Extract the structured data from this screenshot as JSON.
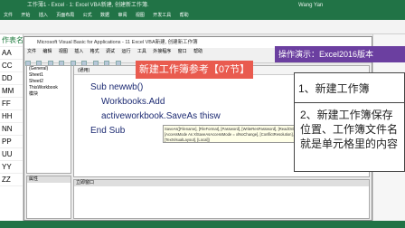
{
  "excel": {
    "title": "工作薄1 - Excel  ·  1: Excel VBA新建, 创建新工作簿.",
    "user": "Wang Yan",
    "tabs": [
      "文件",
      "开始",
      "插入",
      "页面布局",
      "公式",
      "数据",
      "审阅",
      "视图",
      "开发工具",
      "帮助"
    ],
    "row_labels": [
      "作表名",
      "AA",
      "CC",
      "DD",
      "MM",
      "FF",
      "HH",
      "NN",
      "PP",
      "UU",
      "YY",
      "ZZ"
    ]
  },
  "vbe": {
    "title": "Microsoft Visual Basic for Applications - 11 Excel VBA新建, 创建新工作簿",
    "menu": [
      "文件",
      "编辑",
      "视图",
      "插入",
      "格式",
      "调试",
      "运行",
      "工具",
      "外接程序",
      "窗口",
      "帮助"
    ],
    "project_items": [
      "(General)",
      "Sheet1",
      "Sheet2",
      "ThisWorkbook",
      "模块"
    ],
    "code_header": "(通用)",
    "code_lines": [
      "Sub newwb()",
      "Workbooks.Add",
      "activeworkbook.SaveAs thisw",
      "End Sub"
    ],
    "tooltip": "SaveAs([Filename], [FileFormat], [Password], [WriteResPassword], [ReadOnlyRecommended], [CreateBackup], [AccessMode As XlSaveAsAccessMode = xlNoChange], [ConflictResolution], [AddToMru], [TextCodepage], [TextVisualLayout], [Local])",
    "immediate_caption": "立即窗口",
    "props_caption": "属性"
  },
  "overlay": {
    "annotation_title": "新建工作簿参考【07节】",
    "banner": "操作演示：Excel2016版本",
    "note_1": "1、新建工作簿",
    "note_2": "2、新建工作簿保存位置、工作簿文件名就是单元格里的内容"
  },
  "colors": {
    "excel_green": "#217346",
    "annotation_red": "#e95b4f",
    "banner_purple": "#6b3fa0",
    "code_blue": "#1c2a72"
  }
}
